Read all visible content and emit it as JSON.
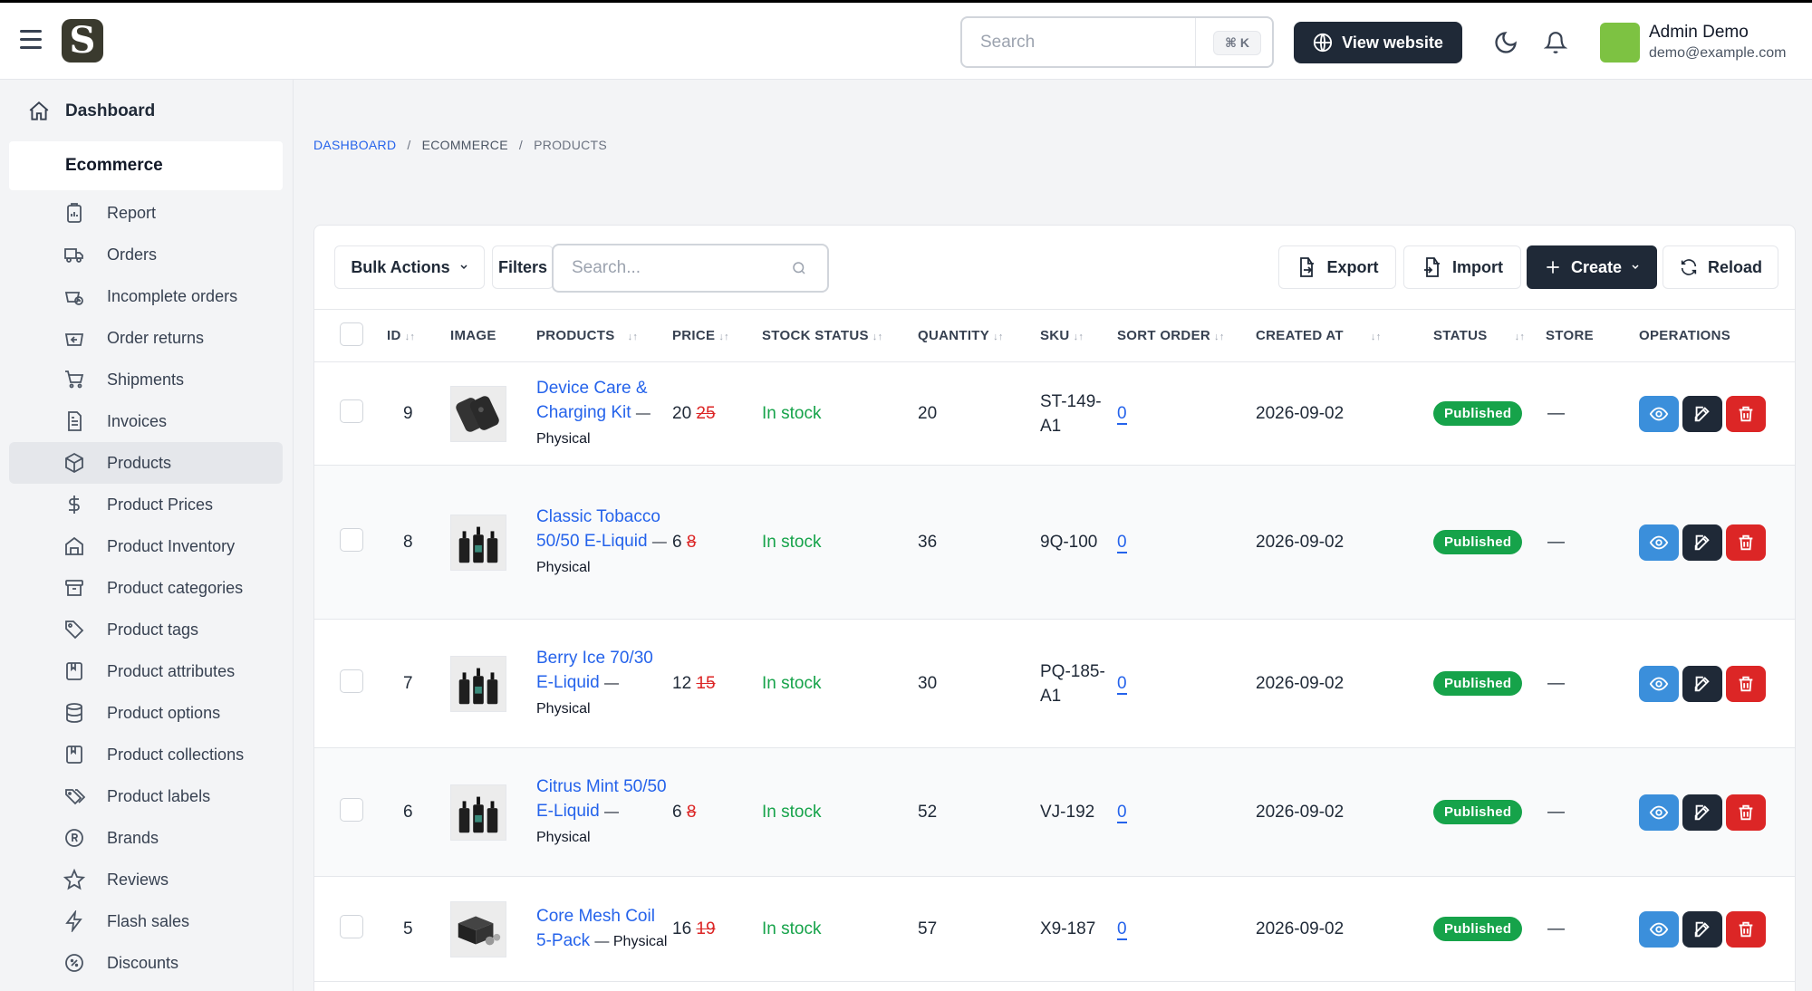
{
  "header": {
    "search_placeholder": "Search",
    "search_shortcut": "⌘ K",
    "view_website": "View website",
    "user_name": "Admin Demo",
    "user_email": "demo@example.com",
    "logo_letter": "S"
  },
  "sidebar": {
    "dashboard": "Dashboard",
    "section": "Ecommerce",
    "items": [
      {
        "label": "Report"
      },
      {
        "label": "Orders"
      },
      {
        "label": "Incomplete orders"
      },
      {
        "label": "Order returns"
      },
      {
        "label": "Shipments"
      },
      {
        "label": "Invoices"
      },
      {
        "label": "Products"
      },
      {
        "label": "Product Prices"
      },
      {
        "label": "Product Inventory"
      },
      {
        "label": "Product categories"
      },
      {
        "label": "Product tags"
      },
      {
        "label": "Product attributes"
      },
      {
        "label": "Product options"
      },
      {
        "label": "Product collections"
      },
      {
        "label": "Product labels"
      },
      {
        "label": "Brands"
      },
      {
        "label": "Reviews"
      },
      {
        "label": "Flash sales"
      },
      {
        "label": "Discounts"
      }
    ]
  },
  "breadcrumb": [
    "DASHBOARD",
    "ECOMMERCE",
    "PRODUCTS"
  ],
  "toolbar": {
    "bulk_actions": "Bulk Actions",
    "filters": "Filters",
    "search_placeholder": "Search...",
    "export": "Export",
    "import": "Import",
    "create": "Create",
    "reload": "Reload"
  },
  "table": {
    "columns": [
      "ID",
      "IMAGE",
      "PRODUCTS",
      "PRICE",
      "STOCK STATUS",
      "QUANTITY",
      "SKU",
      "SORT ORDER",
      "CREATED AT",
      "STATUS",
      "STORE",
      "OPERATIONS"
    ],
    "rows": [
      {
        "id": "9",
        "name": "Device Care & Charging Kit",
        "type": "Physical",
        "price": "20",
        "old_price": "25",
        "stock": "In stock",
        "qty": "20",
        "sku": "ST-149-A1",
        "sort": "0",
        "created": "2026-09-02",
        "status": "Published",
        "store": "—"
      },
      {
        "id": "8",
        "name": "Classic Tobacco 50/50 E-Liquid",
        "type": "Physical",
        "price": "6",
        "old_price": "8",
        "stock": "In stock",
        "qty": "36",
        "sku": "9Q-100",
        "sort": "0",
        "created": "2026-09-02",
        "status": "Published",
        "store": "—"
      },
      {
        "id": "7",
        "name": "Berry Ice 70/30 E-Liquid",
        "type": "Physical",
        "price": "12",
        "old_price": "15",
        "stock": "In stock",
        "qty": "30",
        "sku": "PQ-185-A1",
        "sort": "0",
        "created": "2026-09-02",
        "status": "Published",
        "store": "—"
      },
      {
        "id": "6",
        "name": "Citrus Mint 50/50 E-Liquid",
        "type": "Physical",
        "price": "6",
        "old_price": "8",
        "stock": "In stock",
        "qty": "52",
        "sku": "VJ-192",
        "sort": "0",
        "created": "2026-09-02",
        "status": "Published",
        "store": "—"
      },
      {
        "id": "5",
        "name": "Core Mesh Coil 5-Pack",
        "type": "Physical",
        "price": "16",
        "old_price": "19",
        "stock": "In stock",
        "qty": "57",
        "sku": "X9-187",
        "sort": "0",
        "created": "2026-09-02",
        "status": "Published",
        "store": "—"
      }
    ]
  }
}
